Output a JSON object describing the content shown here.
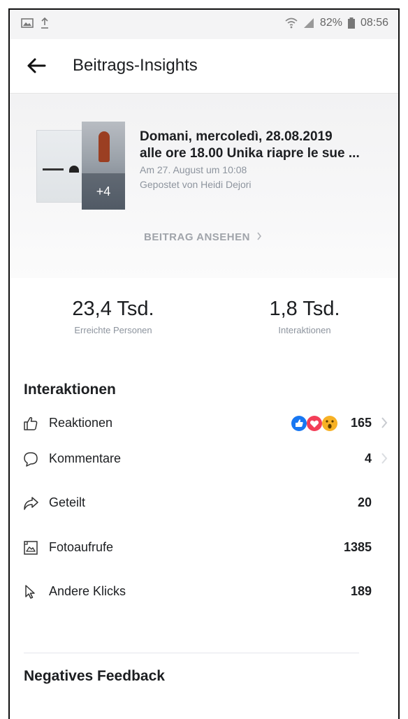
{
  "status_bar": {
    "battery": "82%",
    "time": "08:56"
  },
  "header": {
    "title": "Beitrags-Insights"
  },
  "post": {
    "title_line1": "Domani, mercoledì, 28.08.2019",
    "title_line2": "alle ore 18.00 Unika riapre le sue ...",
    "date": "Am 27. August um 10:08",
    "posted_by": "Gepostet von Heidi Dejori",
    "more_images": "+4",
    "view_label": "BEITRAG ANSEHEN"
  },
  "stats": {
    "reach_value": "23,4 Tsd.",
    "reach_label": "Erreichte Personen",
    "interactions_value": "1,8 Tsd.",
    "interactions_label": "Interaktionen"
  },
  "interactions": {
    "section_title": "Interaktionen",
    "rows": [
      {
        "label": "Reaktionen",
        "value": "165",
        "icon": "thumbs-up-icon"
      },
      {
        "label": "Kommentare",
        "value": "4",
        "icon": "comment-icon"
      },
      {
        "label": "Geteilt",
        "value": "20",
        "icon": "share-icon"
      },
      {
        "label": "Fotoaufrufe",
        "value": "1385",
        "icon": "photo-icon"
      },
      {
        "label": "Andere Klicks",
        "value": "189",
        "icon": "cursor-icon"
      }
    ]
  },
  "negative_feedback": {
    "section_title": "Negatives Feedback"
  },
  "colors": {
    "like_blue": "#1877f2",
    "love_red": "#f33e58",
    "wow_yellow": "#f7b125",
    "muted_text": "#8d949e"
  }
}
